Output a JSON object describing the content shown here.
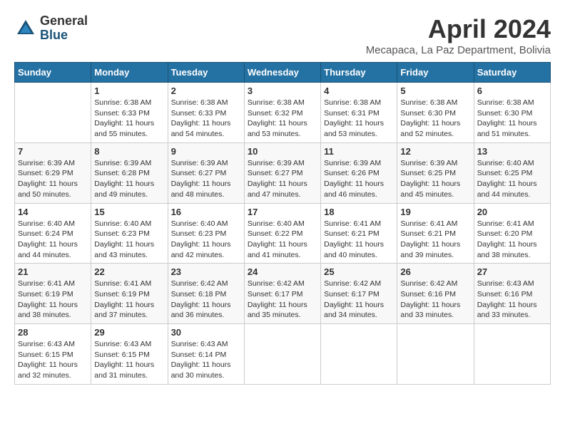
{
  "logo": {
    "general": "General",
    "blue": "Blue"
  },
  "title": "April 2024",
  "location": "Mecapaca, La Paz Department, Bolivia",
  "headers": [
    "Sunday",
    "Monday",
    "Tuesday",
    "Wednesday",
    "Thursday",
    "Friday",
    "Saturday"
  ],
  "weeks": [
    [
      {
        "day": "",
        "sunrise": "",
        "sunset": "",
        "daylight": ""
      },
      {
        "day": "1",
        "sunrise": "Sunrise: 6:38 AM",
        "sunset": "Sunset: 6:33 PM",
        "daylight": "Daylight: 11 hours and 55 minutes."
      },
      {
        "day": "2",
        "sunrise": "Sunrise: 6:38 AM",
        "sunset": "Sunset: 6:33 PM",
        "daylight": "Daylight: 11 hours and 54 minutes."
      },
      {
        "day": "3",
        "sunrise": "Sunrise: 6:38 AM",
        "sunset": "Sunset: 6:32 PM",
        "daylight": "Daylight: 11 hours and 53 minutes."
      },
      {
        "day": "4",
        "sunrise": "Sunrise: 6:38 AM",
        "sunset": "Sunset: 6:31 PM",
        "daylight": "Daylight: 11 hours and 53 minutes."
      },
      {
        "day": "5",
        "sunrise": "Sunrise: 6:38 AM",
        "sunset": "Sunset: 6:30 PM",
        "daylight": "Daylight: 11 hours and 52 minutes."
      },
      {
        "day": "6",
        "sunrise": "Sunrise: 6:38 AM",
        "sunset": "Sunset: 6:30 PM",
        "daylight": "Daylight: 11 hours and 51 minutes."
      }
    ],
    [
      {
        "day": "7",
        "sunrise": "Sunrise: 6:39 AM",
        "sunset": "Sunset: 6:29 PM",
        "daylight": "Daylight: 11 hours and 50 minutes."
      },
      {
        "day": "8",
        "sunrise": "Sunrise: 6:39 AM",
        "sunset": "Sunset: 6:28 PM",
        "daylight": "Daylight: 11 hours and 49 minutes."
      },
      {
        "day": "9",
        "sunrise": "Sunrise: 6:39 AM",
        "sunset": "Sunset: 6:27 PM",
        "daylight": "Daylight: 11 hours and 48 minutes."
      },
      {
        "day": "10",
        "sunrise": "Sunrise: 6:39 AM",
        "sunset": "Sunset: 6:27 PM",
        "daylight": "Daylight: 11 hours and 47 minutes."
      },
      {
        "day": "11",
        "sunrise": "Sunrise: 6:39 AM",
        "sunset": "Sunset: 6:26 PM",
        "daylight": "Daylight: 11 hours and 46 minutes."
      },
      {
        "day": "12",
        "sunrise": "Sunrise: 6:39 AM",
        "sunset": "Sunset: 6:25 PM",
        "daylight": "Daylight: 11 hours and 45 minutes."
      },
      {
        "day": "13",
        "sunrise": "Sunrise: 6:40 AM",
        "sunset": "Sunset: 6:25 PM",
        "daylight": "Daylight: 11 hours and 44 minutes."
      }
    ],
    [
      {
        "day": "14",
        "sunrise": "Sunrise: 6:40 AM",
        "sunset": "Sunset: 6:24 PM",
        "daylight": "Daylight: 11 hours and 44 minutes."
      },
      {
        "day": "15",
        "sunrise": "Sunrise: 6:40 AM",
        "sunset": "Sunset: 6:23 PM",
        "daylight": "Daylight: 11 hours and 43 minutes."
      },
      {
        "day": "16",
        "sunrise": "Sunrise: 6:40 AM",
        "sunset": "Sunset: 6:23 PM",
        "daylight": "Daylight: 11 hours and 42 minutes."
      },
      {
        "day": "17",
        "sunrise": "Sunrise: 6:40 AM",
        "sunset": "Sunset: 6:22 PM",
        "daylight": "Daylight: 11 hours and 41 minutes."
      },
      {
        "day": "18",
        "sunrise": "Sunrise: 6:41 AM",
        "sunset": "Sunset: 6:21 PM",
        "daylight": "Daylight: 11 hours and 40 minutes."
      },
      {
        "day": "19",
        "sunrise": "Sunrise: 6:41 AM",
        "sunset": "Sunset: 6:21 PM",
        "daylight": "Daylight: 11 hours and 39 minutes."
      },
      {
        "day": "20",
        "sunrise": "Sunrise: 6:41 AM",
        "sunset": "Sunset: 6:20 PM",
        "daylight": "Daylight: 11 hours and 38 minutes."
      }
    ],
    [
      {
        "day": "21",
        "sunrise": "Sunrise: 6:41 AM",
        "sunset": "Sunset: 6:19 PM",
        "daylight": "Daylight: 11 hours and 38 minutes."
      },
      {
        "day": "22",
        "sunrise": "Sunrise: 6:41 AM",
        "sunset": "Sunset: 6:19 PM",
        "daylight": "Daylight: 11 hours and 37 minutes."
      },
      {
        "day": "23",
        "sunrise": "Sunrise: 6:42 AM",
        "sunset": "Sunset: 6:18 PM",
        "daylight": "Daylight: 11 hours and 36 minutes."
      },
      {
        "day": "24",
        "sunrise": "Sunrise: 6:42 AM",
        "sunset": "Sunset: 6:17 PM",
        "daylight": "Daylight: 11 hours and 35 minutes."
      },
      {
        "day": "25",
        "sunrise": "Sunrise: 6:42 AM",
        "sunset": "Sunset: 6:17 PM",
        "daylight": "Daylight: 11 hours and 34 minutes."
      },
      {
        "day": "26",
        "sunrise": "Sunrise: 6:42 AM",
        "sunset": "Sunset: 6:16 PM",
        "daylight": "Daylight: 11 hours and 33 minutes."
      },
      {
        "day": "27",
        "sunrise": "Sunrise: 6:43 AM",
        "sunset": "Sunset: 6:16 PM",
        "daylight": "Daylight: 11 hours and 33 minutes."
      }
    ],
    [
      {
        "day": "28",
        "sunrise": "Sunrise: 6:43 AM",
        "sunset": "Sunset: 6:15 PM",
        "daylight": "Daylight: 11 hours and 32 minutes."
      },
      {
        "day": "29",
        "sunrise": "Sunrise: 6:43 AM",
        "sunset": "Sunset: 6:15 PM",
        "daylight": "Daylight: 11 hours and 31 minutes."
      },
      {
        "day": "30",
        "sunrise": "Sunrise: 6:43 AM",
        "sunset": "Sunset: 6:14 PM",
        "daylight": "Daylight: 11 hours and 30 minutes."
      },
      {
        "day": "",
        "sunrise": "",
        "sunset": "",
        "daylight": ""
      },
      {
        "day": "",
        "sunrise": "",
        "sunset": "",
        "daylight": ""
      },
      {
        "day": "",
        "sunrise": "",
        "sunset": "",
        "daylight": ""
      },
      {
        "day": "",
        "sunrise": "",
        "sunset": "",
        "daylight": ""
      }
    ]
  ]
}
